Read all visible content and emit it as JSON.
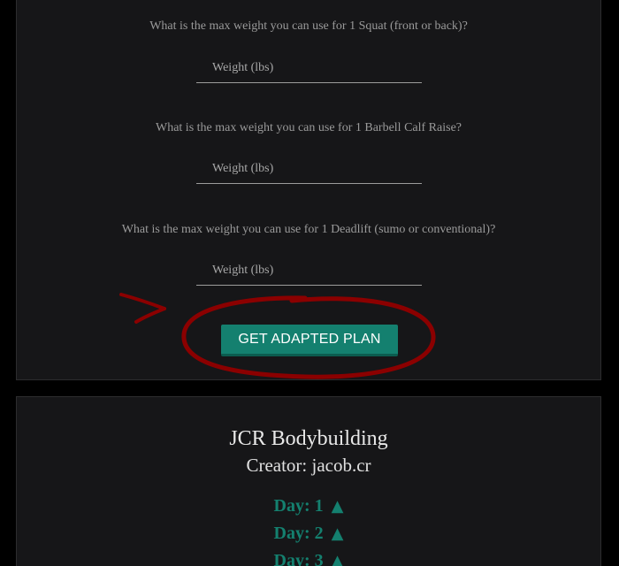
{
  "form": {
    "questions": [
      {
        "label": "What is the max weight you can use for 1 Squat (front or back)?",
        "placeholder": "Weight (lbs)"
      },
      {
        "label": "What is the max weight you can use for 1 Barbell Calf Raise?",
        "placeholder": "Weight (lbs)"
      },
      {
        "label": "What is the max weight you can use for 1 Deadlift (sumo or conventional)?",
        "placeholder": "Weight (lbs)"
      }
    ],
    "submit_label": "GET ADAPTED PLAN"
  },
  "plan": {
    "title": "JCR Bodybuilding",
    "creator": "Creator: jacob.cr",
    "days": [
      {
        "label": "Day: 1",
        "toggle_icon": "▲"
      },
      {
        "label": "Day: 2",
        "toggle_icon": "▲"
      },
      {
        "label": "Day: 3",
        "toggle_icon": "▲"
      }
    ]
  },
  "colors": {
    "accent": "#14806f",
    "annotation": "#8b0000"
  },
  "annotation": {
    "icons": [
      "arrow-annotation-icon",
      "circle-annotation-icon"
    ]
  }
}
